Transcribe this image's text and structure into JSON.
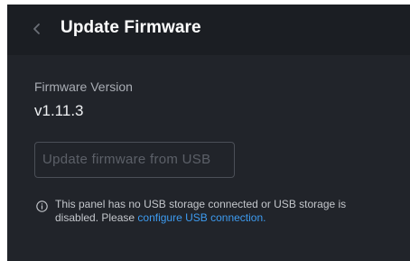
{
  "header": {
    "back_icon": "chevron-left-icon",
    "title": "Update Firmware"
  },
  "firmware": {
    "label": "Firmware Version",
    "version": "v1.11.3"
  },
  "actions": {
    "update_usb_label": "Update firmware from USB",
    "update_usb_enabled": false
  },
  "notice": {
    "icon": "info-icon",
    "text_line1": "This panel has no USB storage connected or USB storage is",
    "text_line2_prefix": "disabled. Please ",
    "link_text": "configure USB connection."
  },
  "colors": {
    "panel_background": "#21242a",
    "header_background": "#1b1e23",
    "link": "#3d9bf0",
    "disabled_text": "#5c6068"
  }
}
